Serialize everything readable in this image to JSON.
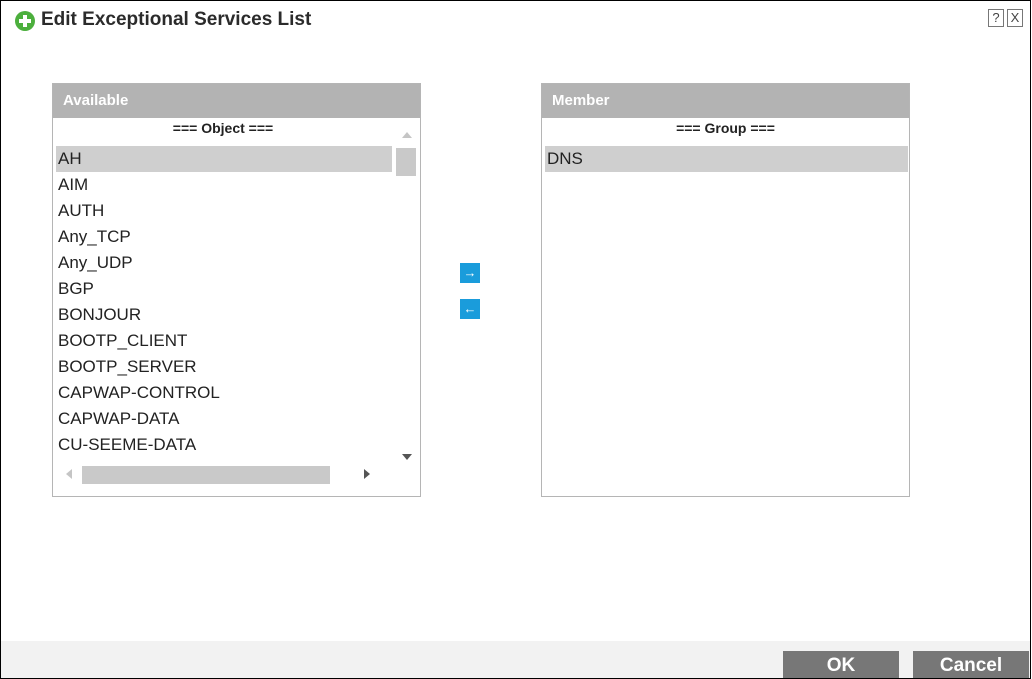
{
  "dialog": {
    "title": "Edit Exceptional Services List",
    "help_label": "?",
    "close_label": "X"
  },
  "available": {
    "header": "Available",
    "caption": "=== Object ===",
    "items": [
      "AH",
      "AIM",
      "AUTH",
      "Any_TCP",
      "Any_UDP",
      "BGP",
      "BONJOUR",
      "BOOTP_CLIENT",
      "BOOTP_SERVER",
      "CAPWAP-CONTROL",
      "CAPWAP-DATA",
      "CU-SEEME-DATA"
    ],
    "selected_item": "AH"
  },
  "member": {
    "header": "Member",
    "caption": "=== Group ===",
    "items": [
      "DNS"
    ],
    "selected_item": "DNS"
  },
  "controls": {
    "move_right_icon": "arrow-right-icon",
    "move_left_icon": "arrow-left-icon",
    "move_right_glyph": "→",
    "move_left_glyph": "←"
  },
  "footer": {
    "ok_label": "OK",
    "cancel_label": "Cancel"
  },
  "colors": {
    "accent_blue": "#1a9cdb",
    "header_gray": "#b3b3b3",
    "button_gray": "#777777",
    "add_icon_green": "#4caf3d"
  }
}
